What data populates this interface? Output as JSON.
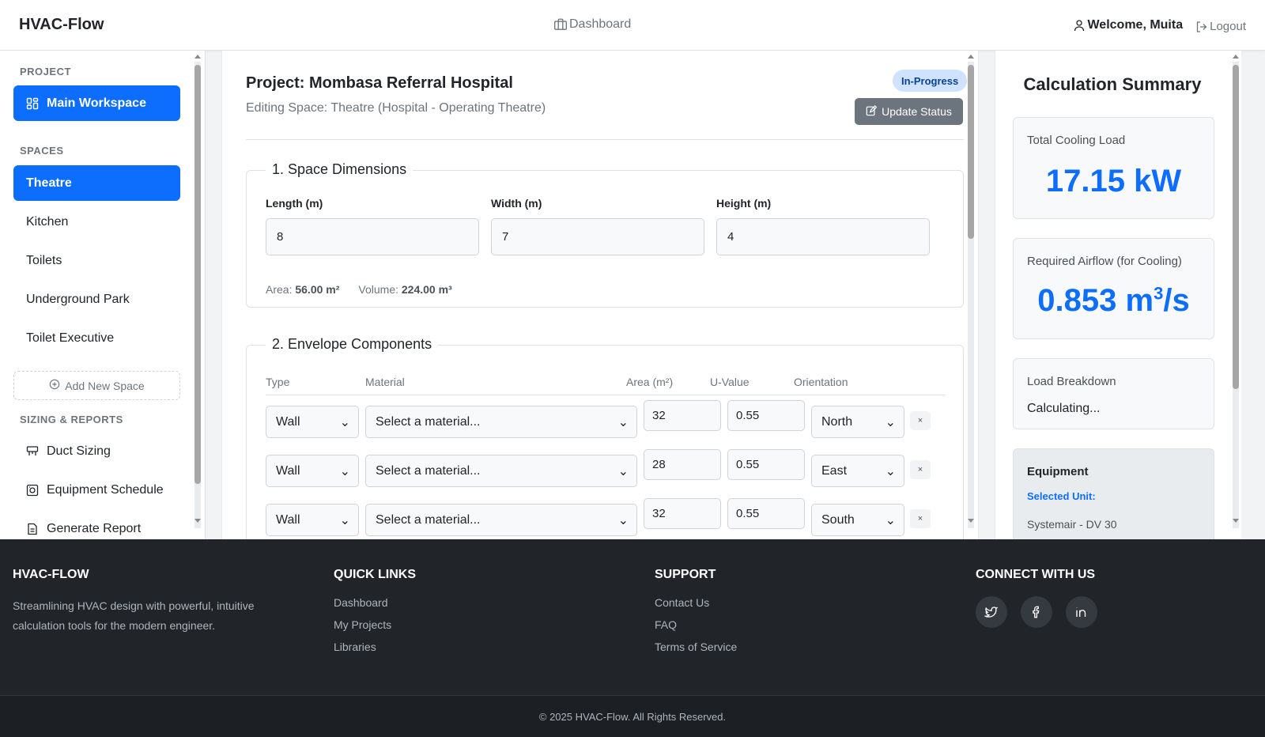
{
  "header": {
    "brand": "HVAC-Flow",
    "dashboard_label": "Dashboard",
    "welcome_label": "Welcome, Muita",
    "logout_label": "Logout"
  },
  "sidebar": {
    "project_heading": "PROJECT",
    "main_workspace": "Main Workspace",
    "spaces_heading": "SPACES",
    "spaces": [
      "Theatre",
      "Kitchen",
      "Toilets",
      "Underground Park",
      "Toilet Executive"
    ],
    "add_space": "Add New Space",
    "reports_heading": "SIZING & REPORTS",
    "reports": [
      "Duct Sizing",
      "Equipment Schedule",
      "Generate Report"
    ]
  },
  "main": {
    "project_title": "Project: Mombasa Referral Hospital",
    "editing_subtitle": "Editing Space: Theatre (Hospital - Operating Theatre)",
    "status_badge": "In-Progress",
    "update_status": "Update Status",
    "dimensions": {
      "legend": "1. Space Dimensions",
      "length_label": "Length (m)",
      "length_value": "8",
      "width_label": "Width (m)",
      "width_value": "7",
      "height_label": "Height (m)",
      "height_value": "4",
      "area_label": "Area:",
      "area_value": "56.00 m²",
      "volume_label": "Volume:",
      "volume_value": "224.00 m³"
    },
    "envelope": {
      "legend": "2. Envelope Components",
      "headers": {
        "type": "Type",
        "material": "Material",
        "area": "Area (m²)",
        "uvalue": "U-Value",
        "orientation": "Orientation"
      },
      "rows": [
        {
          "type": "Wall",
          "material": "Select a material...",
          "area": "32",
          "uvalue": "0.55",
          "orientation": "North"
        },
        {
          "type": "Wall",
          "material": "Select a material...",
          "area": "28",
          "uvalue": "0.55",
          "orientation": "East"
        },
        {
          "type": "Wall",
          "material": "Select a material...",
          "area": "32",
          "uvalue": "0.55",
          "orientation": "South"
        }
      ],
      "remove_glyph": "×"
    }
  },
  "summary": {
    "title": "Calculation Summary",
    "cooling_label": "Total Cooling Load",
    "cooling_value": "17.15 kW",
    "airflow_label": "Required Airflow (for Cooling)",
    "airflow_number": "0.853 m",
    "airflow_exp": "3",
    "airflow_suffix": "/s",
    "breakdown_label": "Load Breakdown",
    "breakdown_value": "Calculating...",
    "equipment_label": "Equipment",
    "selected_unit_label": "Selected Unit:",
    "selected_unit_value": "Systemair - DV 30"
  },
  "footer": {
    "brand_heading": "HVAC-FLOW",
    "brand_text": "Streamlining HVAC design with powerful, intuitive calculation tools for the modern engineer.",
    "quick_heading": "QUICK LINKS",
    "quick_links": [
      "Dashboard",
      "My Projects",
      "Libraries"
    ],
    "support_heading": "SUPPORT",
    "support_links": [
      "Contact Us",
      "FAQ",
      "Terms of Service"
    ],
    "connect_heading": "CONNECT WITH US",
    "copyright": "© 2025 HVAC-Flow. All Rights Reserved."
  },
  "colors": {
    "primary": "#0d6efd",
    "secondary": "#6c757d",
    "footer_bg": "#212529",
    "badge_bg": "#cfe2ff"
  },
  "icons": [
    "briefcase-icon",
    "user-icon",
    "logout-icon",
    "grid-icon",
    "plus-circle-icon",
    "duct-icon",
    "equipment-icon",
    "report-icon",
    "edit-icon",
    "twitter-icon",
    "facebook-icon",
    "linkedin-icon"
  ]
}
